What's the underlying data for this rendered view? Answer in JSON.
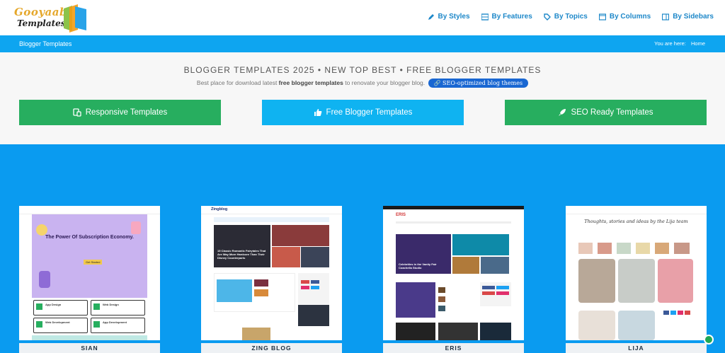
{
  "header": {
    "logo_line1": "Gooyaabi",
    "logo_line2": "Templates",
    "nav": [
      {
        "label": "By Styles",
        "icon": "pencil-icon"
      },
      {
        "label": "By Features",
        "icon": "grid-icon"
      },
      {
        "label": "By Topics",
        "icon": "tag-icon"
      },
      {
        "label": "By Columns",
        "icon": "columns-icon"
      },
      {
        "label": "By Sidebars",
        "icon": "sidebar-icon"
      }
    ]
  },
  "breadcrumb": {
    "title": "Blogger Templates",
    "you_are_here": "You are here:",
    "home": "Home"
  },
  "hero": {
    "title": "BLOGGER TEMPLATES 2025 • NEW TOP BEST • FREE BLOGGER TEMPLATES",
    "sub_prefix": "Best place for download latest ",
    "sub_bold": "free blogger templates",
    "sub_suffix": " to renovate your blogger blog.",
    "pill": "SEO-optimized blog themes"
  },
  "buttons": {
    "responsive": "Responsive Templates",
    "free": "Free Blogger Templates",
    "seo": "SEO Ready Templates"
  },
  "templates": [
    {
      "name": "SIAN",
      "headline": "The Power Of Subscription Economy.",
      "cta": "Get Started",
      "items": [
        "App Design",
        "Web Design",
        "Web Development",
        "App Development"
      ]
    },
    {
      "name": "ZING BLOG",
      "logo": "Zingblog",
      "headline": "15 Classic Romantic Fairytales That Are Way More Hardcore Than Their Disney Counterparts"
    },
    {
      "name": "ERIS",
      "logo": "ERIS",
      "headline": "Celebrities in the Vanity Fair Coachella Studio"
    },
    {
      "name": "LIJA",
      "headline": "Thoughts, stories and ideas by the Lija team"
    }
  ],
  "colors": {
    "accent_blue": "#0a9bf0",
    "bar_blue": "#0ea5f0",
    "button_green": "#27ae5f",
    "button_blue": "#0fb3f1",
    "link_blue": "#1e88c9",
    "pill_blue": "#1967d2"
  }
}
